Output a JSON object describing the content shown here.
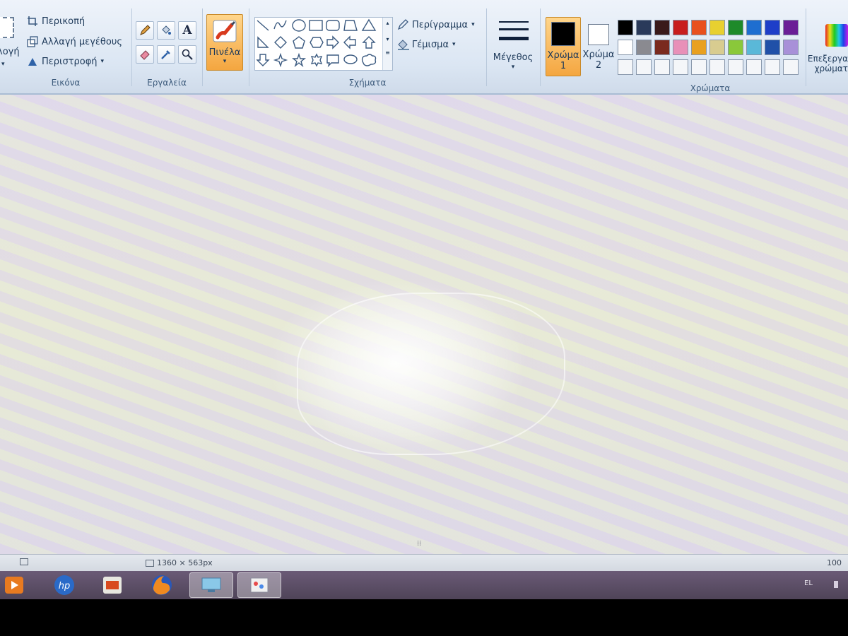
{
  "ribbon": {
    "image_group": {
      "label": "Εικόνα",
      "select_label": "λογή",
      "crop_label": "Περικοπή",
      "resize_label": "Αλλαγή μεγέθους",
      "rotate_label": "Περιστροφή"
    },
    "tools_group": {
      "label": "Εργαλεία",
      "text_tool_glyph": "A"
    },
    "brushes": {
      "label": "Πινέλα"
    },
    "shapes_group": {
      "label": "Σχήματα",
      "outline_label": "Περίγραμμα",
      "fill_label": "Γέμισμα"
    },
    "size": {
      "label": "Μέγεθος"
    },
    "colors_group": {
      "label": "Χρώματα",
      "color1_label": "Χρώμα",
      "color1_num": "1",
      "color2_label": "Χρώμα",
      "color2_num": "2",
      "color1_value": "#000000",
      "color2_value": "#ffffff",
      "edit_colors_label": "Επεξεργα",
      "edit_colors_label2": "χρώματ",
      "palette_row1": [
        "#000000",
        "#2a3a5a",
        "#3a1a1a",
        "#c81e1e",
        "#e8501e",
        "#e8d030",
        "#1e8a2a",
        "#1e6ed0",
        "#1e3ec8",
        "#6a1e96"
      ],
      "palette_row2": [
        "#ffffff",
        "#8a8a90",
        "#7a2a1e",
        "#e890b8",
        "#e8a020",
        "#d8cc90",
        "#8ac83a",
        "#5ab8d8",
        "#2050a8",
        "#a890d8"
      ]
    }
  },
  "status": {
    "dimensions": "1360 × 563px",
    "zoom": "100"
  },
  "taskbar": {
    "lang": "EL"
  }
}
